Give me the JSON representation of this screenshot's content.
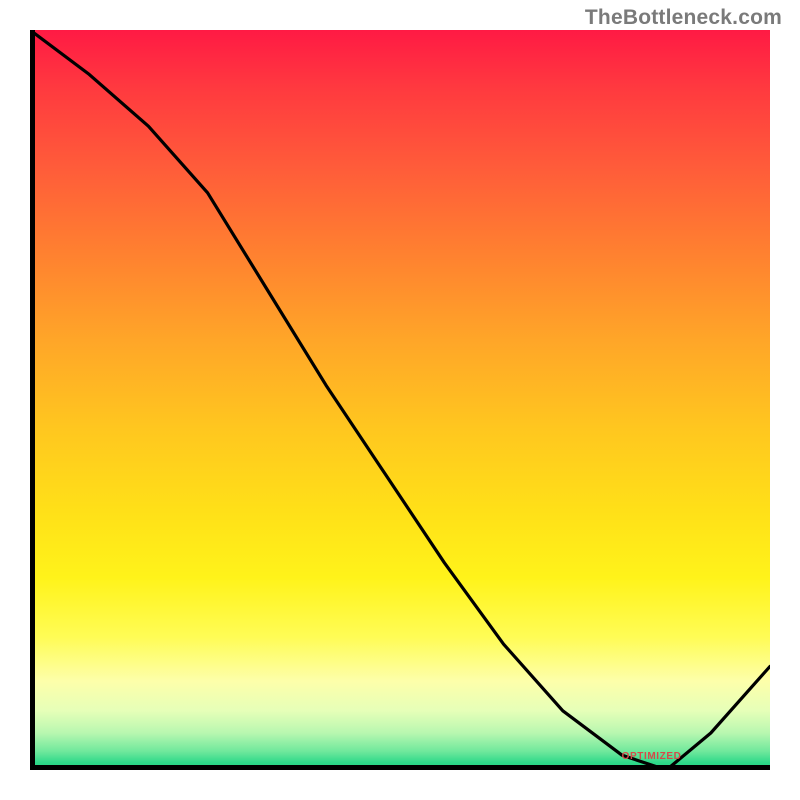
{
  "watermark": "TheBottleneck.com",
  "annotation": {
    "label": "OPTIMIZED"
  },
  "colors": {
    "gradient_top": "#ff1a44",
    "gradient_bottom": "#1ed27f",
    "axis": "#000000",
    "curve": "#000000",
    "annotation": "#d64a4a"
  },
  "chart_data": {
    "type": "line",
    "title": "",
    "xlabel": "",
    "ylabel": "",
    "xlim": [
      0,
      100
    ],
    "ylim": [
      0,
      100
    ],
    "background": "vertical gradient red→yellow→green (high bottleneck at top to optimal at bottom)",
    "series": [
      {
        "name": "bottleneck-curve",
        "x": [
          0,
          8,
          16,
          24,
          32,
          40,
          48,
          56,
          64,
          72,
          80,
          86,
          92,
          100
        ],
        "values": [
          100,
          94,
          87,
          78,
          65,
          52,
          40,
          28,
          17,
          8,
          2,
          0,
          5,
          14
        ]
      }
    ],
    "annotations": [
      {
        "text": "OPTIMIZED",
        "x": 84,
        "y": 1
      }
    ]
  }
}
